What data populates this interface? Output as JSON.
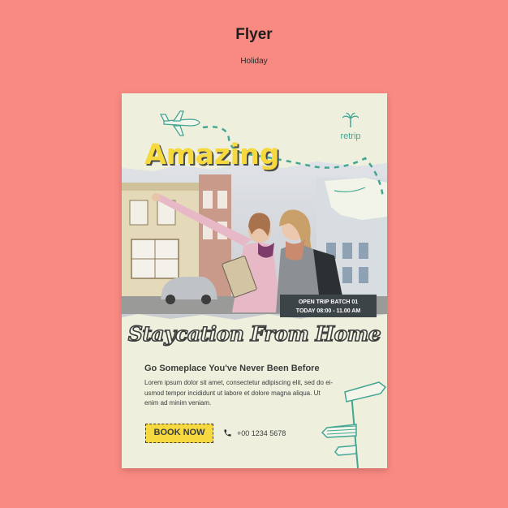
{
  "page": {
    "title": "Flyer",
    "subtitle": "Holiday"
  },
  "flyer": {
    "brand": "retrip",
    "headline": "Amazing",
    "batch_line1": "OPEN TRIP BATCH 01",
    "batch_line2": "TODAY 08:00 - 11.00 AM",
    "script_title": "Staycation From Home",
    "tagline": "Go Someplace You've Never Been Before",
    "body_line1": "Lorem ipsum dolor sit amet, consectetur adipiscing elit, sed do ei-",
    "body_line2": "usmod tempor incididunt ut labore et dolore magna aliqua. Ut",
    "body_line3": "enim ad minim veniam.",
    "button_label": "BOOK NOW",
    "phone": "+00 1234 5678"
  },
  "colors": {
    "background": "#f98a82",
    "flyer_bg": "#eef0dd",
    "accent_yellow": "#f5d93f",
    "accent_teal": "#42a693",
    "dark": "#3d4448"
  },
  "icons": [
    "airplane-icon",
    "palm-tree-icon",
    "phone-icon",
    "signpost-icon"
  ]
}
